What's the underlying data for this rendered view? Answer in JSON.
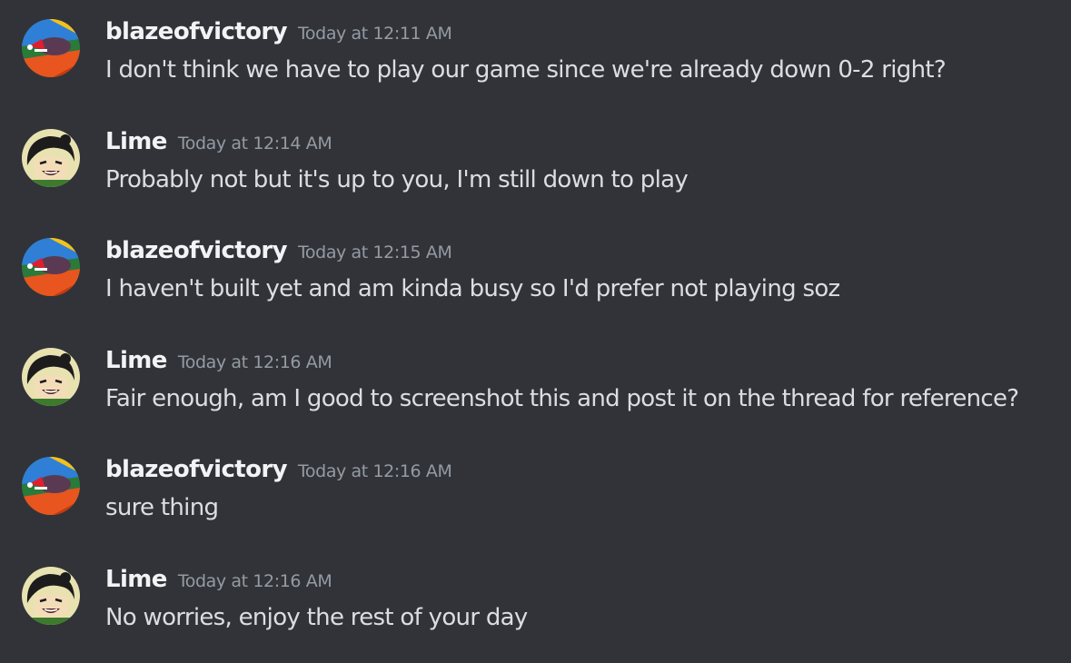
{
  "colors": {
    "background": "#313338",
    "username": "#f2f3f5",
    "timestamp": "#949ba4",
    "message_text": "#dbdee1"
  },
  "messages": [
    {
      "username": "blazeofvictory",
      "timestamp": "Today at 12:11 AM",
      "text": "I don't think we have to play our game since we're already down 0-2 right?",
      "avatar_icon": "blaze-avatar"
    },
    {
      "username": "Lime",
      "timestamp": "Today at 12:14 AM",
      "text": "Probably not but it's up to you, I'm still down to play",
      "avatar_icon": "lime-avatar"
    },
    {
      "username": "blazeofvictory",
      "timestamp": "Today at 12:15 AM",
      "text": "I haven't built yet and am kinda busy so I'd prefer not playing soz",
      "avatar_icon": "blaze-avatar"
    },
    {
      "username": "Lime",
      "timestamp": "Today at 12:16 AM",
      "text": "Fair enough, am I good to screenshot this and post it on the thread for reference?",
      "avatar_icon": "lime-avatar"
    },
    {
      "username": "blazeofvictory",
      "timestamp": "Today at 12:16 AM",
      "text": "sure thing",
      "avatar_icon": "blaze-avatar"
    },
    {
      "username": "Lime",
      "timestamp": "Today at 12:16 AM",
      "text": "No worries, enjoy the rest of your day",
      "avatar_icon": "lime-avatar"
    }
  ]
}
